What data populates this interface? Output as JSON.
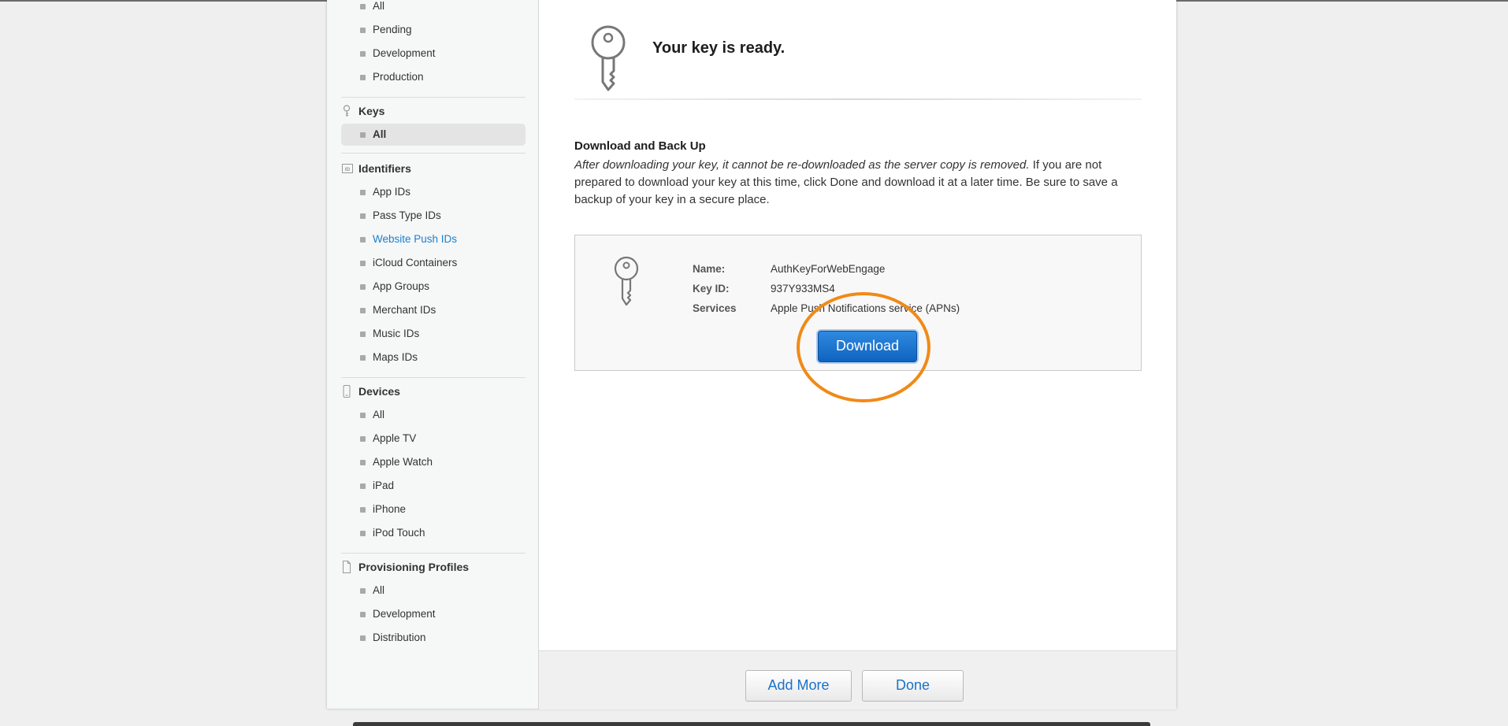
{
  "sidebar": {
    "certificates_items": [
      "All",
      "Pending",
      "Development",
      "Production"
    ],
    "keys": {
      "header": "Keys",
      "items": [
        "All"
      ]
    },
    "identifiers": {
      "header": "Identifiers",
      "items": [
        "App IDs",
        "Pass Type IDs",
        "Website Push IDs",
        "iCloud Containers",
        "App Groups",
        "Merchant IDs",
        "Music IDs",
        "Maps IDs"
      ]
    },
    "devices": {
      "header": "Devices",
      "items": [
        "All",
        "Apple TV",
        "Apple Watch",
        "iPad",
        "iPhone",
        "iPod Touch"
      ]
    },
    "profiles": {
      "header": "Provisioning Profiles",
      "items": [
        "All",
        "Development",
        "Distribution"
      ]
    },
    "identifier_icon_text": "ID"
  },
  "main": {
    "title": "Your key is ready.",
    "section_title": "Download and Back Up",
    "section_text_italic": "After downloading your key, it cannot be re-downloaded as the server copy is removed.",
    "section_text_rest": " If you are not prepared to download your key at this time, click Done and download it at a later time. Be sure to save a backup of your key in a secure place.",
    "key": {
      "name_label": "Name:",
      "name_value": "AuthKeyForWebEngage",
      "id_label": "Key ID:",
      "id_value": "937Y933MS4",
      "services_label": "Services",
      "services_value": "Apple Push Notifications service (APNs)"
    },
    "download_label": "Download"
  },
  "footer": {
    "add_more_label": "Add More",
    "done_label": "Done"
  },
  "colors": {
    "accent": "#1a7fd0",
    "download_button": "#1468c8",
    "highlight": "#f08a16"
  }
}
